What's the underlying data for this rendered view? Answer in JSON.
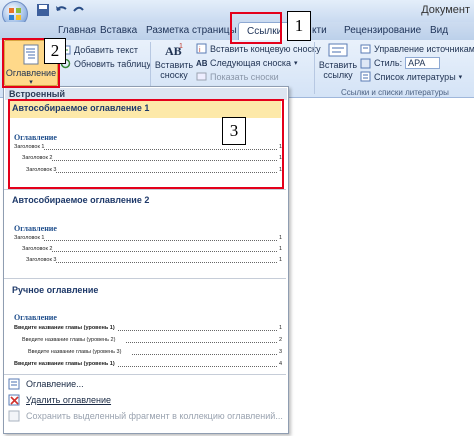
{
  "window": {
    "title": "Документ"
  },
  "tabs": [
    "Главная",
    "Вставка",
    "Разметка страницы",
    "Ссылки",
    "кти",
    "Рецензирование",
    "Вид"
  ],
  "ribbon": {
    "toc_button": "Оглавление",
    "toc_group_items": [
      "Добавить текст",
      "Обновить таблицу"
    ],
    "footnotes": {
      "insert_footnote": [
        "Вставить",
        "сноску"
      ],
      "small": [
        "Вставить концевую сноску",
        "Следующая сноска",
        "Показать сноски"
      ]
    },
    "citations": {
      "insert_link": [
        "Вставить",
        "ссылку"
      ],
      "small": [
        "Управление источниками",
        "Стиль:",
        "APA",
        "Список литературы"
      ],
      "group_label": "Ссылки и списки литературы"
    }
  },
  "dropdown": {
    "header": "Встроенный",
    "galleries": [
      {
        "title": "Автособираемое оглавление 1",
        "heading": "Оглавление",
        "lines": [
          {
            "label": "Заголовок 1",
            "page": "1"
          },
          {
            "label": "Заголовок 2",
            "page": "1"
          },
          {
            "label": "Заголовок 3",
            "page": "1"
          }
        ]
      },
      {
        "title": "Автособираемое оглавление 2",
        "heading": "Оглавление",
        "lines": [
          {
            "label": "Заголовок 1",
            "page": "1"
          },
          {
            "label": "Заголовок 2",
            "page": "1"
          },
          {
            "label": "Заголовок 3",
            "page": "1"
          }
        ]
      },
      {
        "title": "Ручное оглавление",
        "heading": "Оглавление",
        "lines": [
          {
            "label": "Введите название главы (уровень 1)",
            "page": "1"
          },
          {
            "label": "Введите название главы (уровень 2)",
            "page": "2"
          },
          {
            "label": "Введите название главы (уровень 3)",
            "page": "3"
          },
          {
            "label": "Введите название главы (уровень 1)",
            "page": "4"
          }
        ]
      }
    ],
    "commands": [
      "Оглавление...",
      "Удалить оглавление",
      "Сохранить выделенный фрагмент в коллекцию оглавлений..."
    ]
  },
  "annotations": [
    "1",
    "2",
    "3"
  ],
  "colors": {
    "highlight": "#e4001b",
    "accent": "#1f4e8c"
  }
}
